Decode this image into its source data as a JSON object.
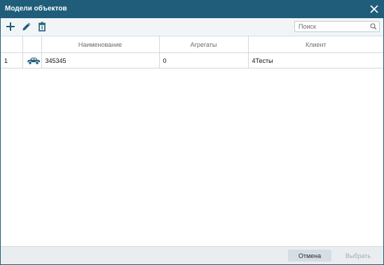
{
  "dialog": {
    "title": "Модели объектов",
    "close_icon": "close-icon"
  },
  "toolbar": {
    "add_icon": "plus-icon",
    "edit_icon": "pencil-icon",
    "delete_icon": "trash-icon",
    "search_placeholder": "Поиск",
    "search_value": ""
  },
  "table": {
    "columns": [
      "",
      "",
      "Наименование",
      "Агрегаты",
      "Клиент"
    ],
    "rows": [
      {
        "index": "1",
        "icon": "car-icon",
        "name": "345345",
        "aggregates": "0",
        "client": "4Тесты"
      }
    ]
  },
  "footer": {
    "cancel_label": "Отмена",
    "select_label": "Выбрать"
  },
  "colors": {
    "titlebar": "#1f5d7a",
    "icon_blue": "#1f5d7a",
    "footer_bg": "#eaedf0",
    "cancel_bg": "#d6dee5",
    "disabled_text": "#a5acb2"
  }
}
